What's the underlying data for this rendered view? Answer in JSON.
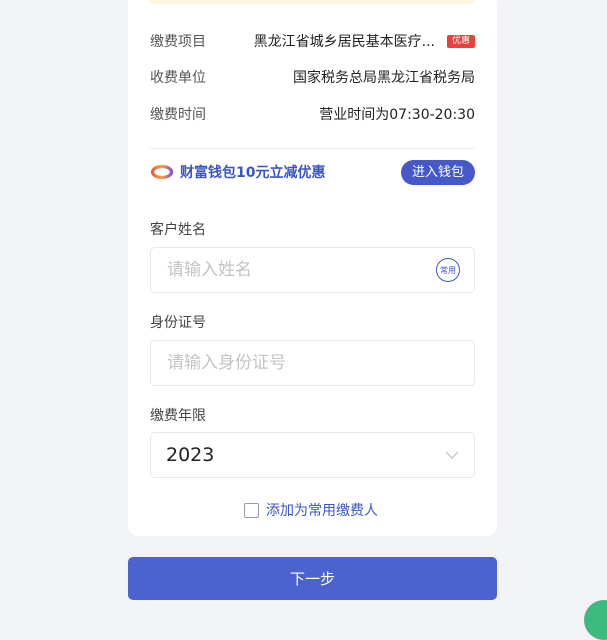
{
  "payment_info": {
    "item_label": "缴费项目",
    "item_value": "黑龙江省城乡居民基本医疗...",
    "item_badge": "优惠",
    "unit_label": "收费单位",
    "unit_value": "国家税务总局黑龙江省税务局",
    "time_label": "缴费时间",
    "time_value": "营业时间为07:30-20:30"
  },
  "wallet": {
    "promo_text": "财富钱包10元立减优惠",
    "button_label": "进入钱包"
  },
  "form": {
    "name_label": "客户姓名",
    "name_placeholder": "请输入姓名",
    "common_icon_text": "常用",
    "id_label": "身份证号",
    "id_placeholder": "请输入身份证号",
    "year_label": "缴费年限",
    "year_value": "2023",
    "add_common_label": "添加为常用缴费人"
  },
  "actions": {
    "next_label": "下一步"
  },
  "colors": {
    "accent": "#4c63cf",
    "badge": "#e8413e",
    "background": "#f2f3f7"
  }
}
